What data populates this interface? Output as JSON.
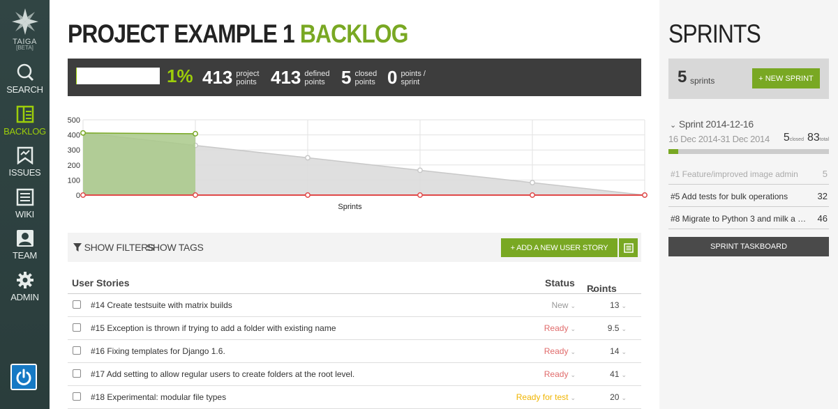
{
  "nav": {
    "logo": {
      "name": "TAIGA",
      "beta": "[BETA]"
    },
    "items": [
      {
        "label": "SEARCH",
        "icon": "search-icon"
      },
      {
        "label": "BACKLOG",
        "icon": "backlog-icon",
        "active": true
      },
      {
        "label": "ISSUES",
        "icon": "issues-icon"
      },
      {
        "label": "WIKI",
        "icon": "wiki-icon"
      },
      {
        "label": "TEAM",
        "icon": "team-icon"
      },
      {
        "label": "ADMIN",
        "icon": "gear-icon"
      }
    ],
    "logout_icon": "power-icon"
  },
  "header": {
    "title_project": "PROJECT EXAMPLE 1",
    "title_section": "BACKLOG"
  },
  "stats": {
    "progress_fraction": 0.01,
    "percent": "1%",
    "project_points": {
      "num": "413",
      "l1": "project",
      "l2": "points"
    },
    "defined_points": {
      "num": "413",
      "l1": "defined",
      "l2": "points"
    },
    "closed_points": {
      "num": "5",
      "l1": "closed",
      "l2": "points"
    },
    "points_per_sprint": {
      "num": "0",
      "l1": "points /",
      "l2": "sprint"
    }
  },
  "chart_data": {
    "type": "line",
    "xlabel": "Sprints",
    "ylabel": "",
    "ylim": [
      0,
      500
    ],
    "yticks": [
      0,
      100,
      200,
      300,
      400,
      500
    ],
    "x": [
      0,
      1,
      2,
      3,
      4,
      5
    ],
    "grid": true,
    "series": [
      {
        "values": [
          413,
          330,
          248,
          165,
          83,
          0
        ],
        "color": "#c8c8c8",
        "fill": "#dcdcdc"
      },
      {
        "values": [
          413,
          408
        ],
        "color": "#79a823",
        "fill": "#a9c98a"
      },
      {
        "values": [
          0,
          0,
          0,
          0,
          0,
          0
        ],
        "color": "#e04848"
      }
    ]
  },
  "toolbar": {
    "show_filters": "SHOW FILTERS",
    "show_tags": "SHOW TAGS",
    "add_story": "+ ADD A NEW USER STORY",
    "filter_icon": "funnel-icon",
    "toggle_icon": "list-view-icon"
  },
  "table": {
    "headers": {
      "stories": "User Stories",
      "status": "Status",
      "points": "Points"
    },
    "rows": [
      {
        "subject": "#14 Create testsuite with matrix builds",
        "status": "New",
        "status_color": "#999999",
        "points": "13"
      },
      {
        "subject": "#15 Exception is thrown if trying to add a folder with existing name",
        "status": "Ready",
        "status_color": "#e06b6b",
        "points": "9.5"
      },
      {
        "subject": "#16 Fixing templates for Django 1.6.",
        "status": "Ready",
        "status_color": "#e06b6b",
        "points": "14"
      },
      {
        "subject": "#17 Add setting to allow regular users to create folders at the root level.",
        "status": "Ready",
        "status_color": "#e06b6b",
        "points": "41"
      },
      {
        "subject": "#18 Experimental: modular file types",
        "status": "Ready for test",
        "status_color": "#f0b400",
        "points": "20"
      }
    ]
  },
  "sidebar": {
    "title": "SPRINTS",
    "sprint_count": "5",
    "sprint_count_label": "sprints",
    "new_sprint": "+ NEW SPRINT",
    "sprint": {
      "name": "Sprint 2014-12-16",
      "dates": "16 Dec 2014-31 Dec 2014",
      "closed": "5",
      "closed_label": "closed",
      "total": "83",
      "total_label": "total",
      "progress_fraction": 0.06,
      "items": [
        {
          "title": "#1 Feature/improved image admin",
          "points": "5",
          "closed": true
        },
        {
          "title": "#5 Add tests for bulk operations",
          "points": "32",
          "closed": false
        },
        {
          "title": "#8 Migrate to Python 3 and milk a bea...",
          "points": "46",
          "closed": false
        }
      ]
    },
    "taskboard": "SPRINT TASKBOARD"
  }
}
